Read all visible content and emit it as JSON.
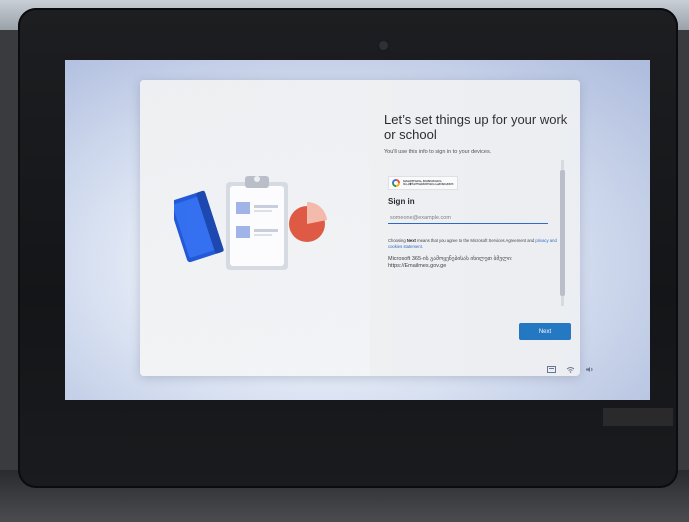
{
  "oobe": {
    "title": "Let’s set things up for your work or school",
    "subtitle": "You'll use this info to sign in to your devices.",
    "org_logo_lines": [
      "ᲒᲐᲜᲐᲗᲚᲔᲑᲘᲡ, ᲛᲔᲪᲜᲘᲔᲠᲔᲑᲘᲡ",
      "ᲓᲐ Ა�®ᲐᲚᲒᲐᲖᲠᲓᲝᲑᲘᲡ ᲡᲐᲛᲘᲜᲘᲡᲢᲠᲝ"
    ],
    "signin_heading": "Sign in",
    "email_placeholder": "someone@example.com",
    "terms_prefix": "Choosing ",
    "terms_next_word": "Next",
    "terms_middle": " means that you agree to the Microsoft Services Agreement and",
    "terms_link": "privacy and cookies statement.",
    "portal_note_line1": "Microsoft 365-ის გამოყენებისას იხილეთ ბმული:",
    "portal_note_line2": "https://Emailmes.gov.ge",
    "next_label": "Next"
  },
  "taskbar": {
    "icons": [
      "accessibility-icon",
      "network-icon",
      "volume-icon"
    ]
  },
  "colors": {
    "accent": "#0f6cbd",
    "dialog_bg": "#f2f3f4",
    "illus_blue": "#1f55d6",
    "illus_orange": "#e0533a"
  }
}
